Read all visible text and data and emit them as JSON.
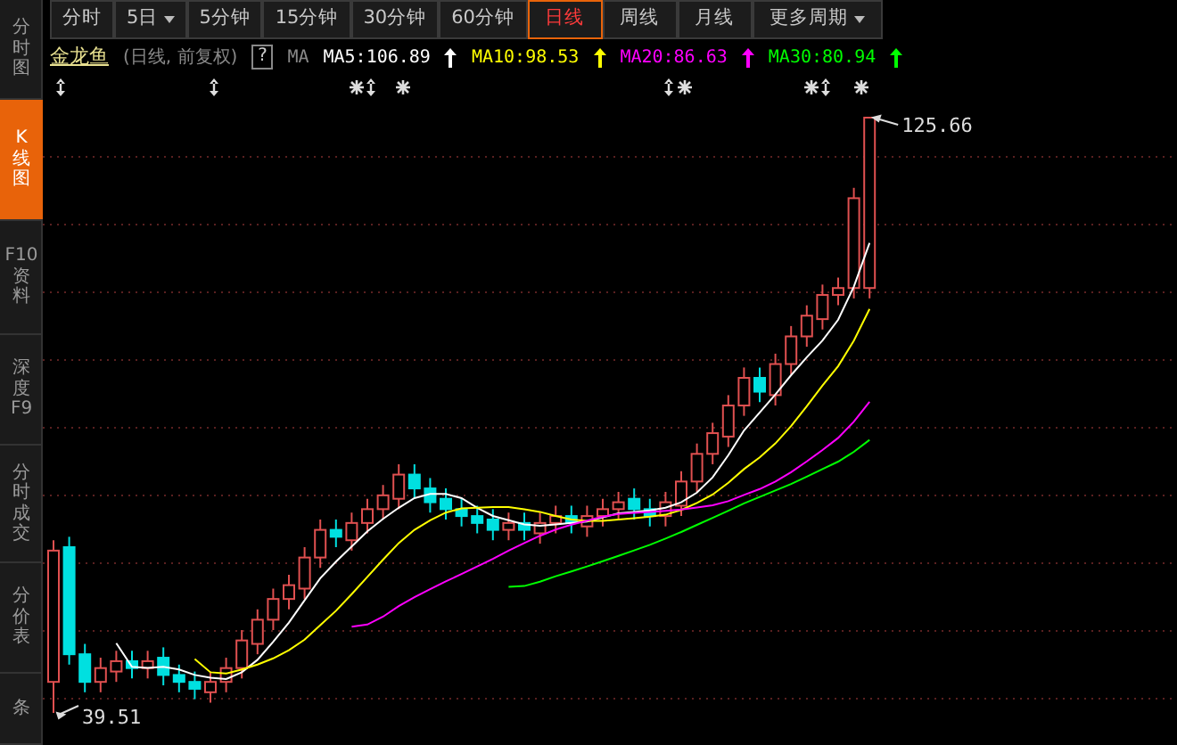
{
  "sidebar": {
    "items": [
      {
        "label": "分时图",
        "selected": false
      },
      {
        "label": "K线图",
        "selected": true
      },
      {
        "label": "F10资料",
        "selected": false
      },
      {
        "label": "深度F9",
        "selected": false
      },
      {
        "label": "分时成交",
        "selected": false
      },
      {
        "label": "分价表",
        "selected": false
      },
      {
        "label": "条",
        "selected": false
      }
    ]
  },
  "period_tabs": [
    {
      "label": "分时",
      "selected": false,
      "dropdown": false
    },
    {
      "label": "5日",
      "selected": false,
      "dropdown": true
    },
    {
      "label": "5分钟",
      "selected": false,
      "dropdown": false
    },
    {
      "label": "15分钟",
      "selected": false,
      "dropdown": false
    },
    {
      "label": "30分钟",
      "selected": false,
      "dropdown": false
    },
    {
      "label": "60分钟",
      "selected": false,
      "dropdown": false
    },
    {
      "label": "日线",
      "selected": true,
      "dropdown": false
    },
    {
      "label": "周线",
      "selected": false,
      "dropdown": false
    },
    {
      "label": "月线",
      "selected": false,
      "dropdown": false
    },
    {
      "label": "更多周期",
      "selected": false,
      "dropdown": true
    }
  ],
  "legend": {
    "stock_name": "金龙鱼",
    "mode": "(日线, 前复权)",
    "help": "?",
    "ma_label": "MA",
    "averages": [
      {
        "text": "MA5:106.89",
        "color": "#ffffff",
        "rising": true
      },
      {
        "text": "MA10:98.53",
        "color": "#ffff00",
        "rising": true
      },
      {
        "text": "MA20:86.63",
        "color": "#ff00ff",
        "rising": true
      },
      {
        "text": "MA30:80.94",
        "color": "#00ff00",
        "rising": true
      }
    ]
  },
  "chart": {
    "high_label": "125.66",
    "low_label": "39.51"
  }
}
